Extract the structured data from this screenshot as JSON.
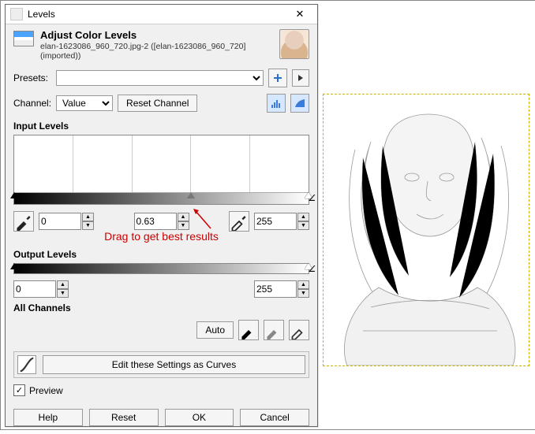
{
  "window": {
    "title": "Levels",
    "close": "✕"
  },
  "header": {
    "title": "Adjust Color Levels",
    "subtitle": "elan-1623086_960_720.jpg-2 ([elan-1623086_960_720] (imported))"
  },
  "presets": {
    "label": "Presets:",
    "value": "",
    "add_icon": "add",
    "menu_icon": "menu"
  },
  "channel": {
    "label": "Channel:",
    "value": "Value",
    "reset_button": "Reset Channel"
  },
  "input": {
    "section": "Input Levels",
    "black": "0",
    "gamma": "0.63",
    "white": "255"
  },
  "annotation": "Drag to get best results",
  "output": {
    "section": "Output Levels",
    "black": "0",
    "white": "255"
  },
  "allch": {
    "section": "All Channels",
    "auto": "Auto"
  },
  "curves": {
    "label": "Edit these Settings as Curves"
  },
  "preview": {
    "label": "Preview",
    "checked": "✓"
  },
  "footer": {
    "help": "Help",
    "reset": "Reset",
    "ok": "OK",
    "cancel": "Cancel"
  }
}
